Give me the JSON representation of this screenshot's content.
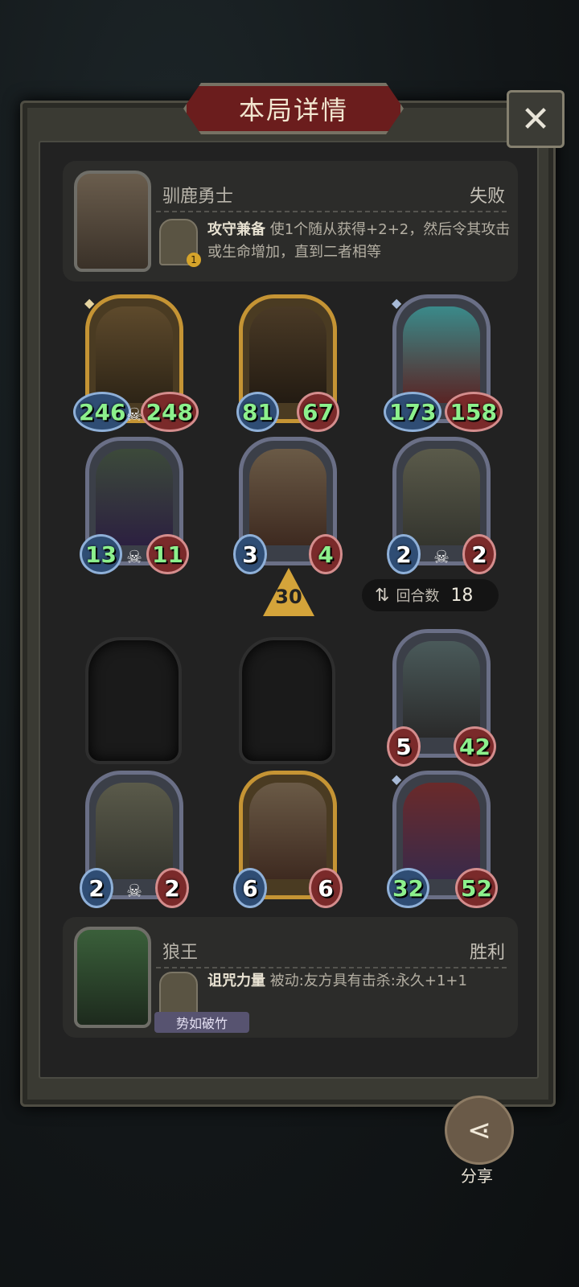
{
  "title": "本局详情",
  "close_label": "✕",
  "opponent": {
    "name": "驯鹿勇士",
    "result": "失败",
    "skill_name": "攻守兼备",
    "skill_desc": "使1个随从获得+2+2，然后令其攻击或生命增加，直到二者相等"
  },
  "player": {
    "name": "狼王",
    "result": "胜利",
    "skill_name": "诅咒力量",
    "skill_desc": "被动:友方具有击杀:永久+1+1",
    "badge": "势如破竹"
  },
  "opponent_cards": [
    {
      "atk": "246",
      "hp": "248",
      "frame": "gold",
      "skull": true,
      "buffed": true
    },
    {
      "atk": "81",
      "hp": "67",
      "frame": "gold",
      "skull": false,
      "buffed": true
    },
    {
      "atk": "173",
      "hp": "158",
      "frame": "silver",
      "skull": false,
      "buffed": true
    },
    {
      "atk": "13",
      "hp": "11",
      "frame": "silver",
      "skull": true,
      "buffed": true
    },
    {
      "atk": "3",
      "hp": "4",
      "frame": "silver",
      "skull": false,
      "buffed": false
    },
    {
      "atk": "2",
      "hp": "2",
      "frame": "silver",
      "skull": true,
      "buffed": false
    }
  ],
  "player_cards": [
    {
      "atk": "5",
      "hp": "42",
      "frame": "silver"
    },
    {
      "atk": "2",
      "hp": "2",
      "frame": "silver"
    },
    {
      "atk": "6",
      "hp": "6",
      "frame": "gold"
    },
    {
      "atk": "32",
      "hp": "52",
      "frame": "silver"
    }
  ],
  "damage": "30",
  "round_label": "回合数",
  "round_value": "18",
  "share_label": "分享"
}
